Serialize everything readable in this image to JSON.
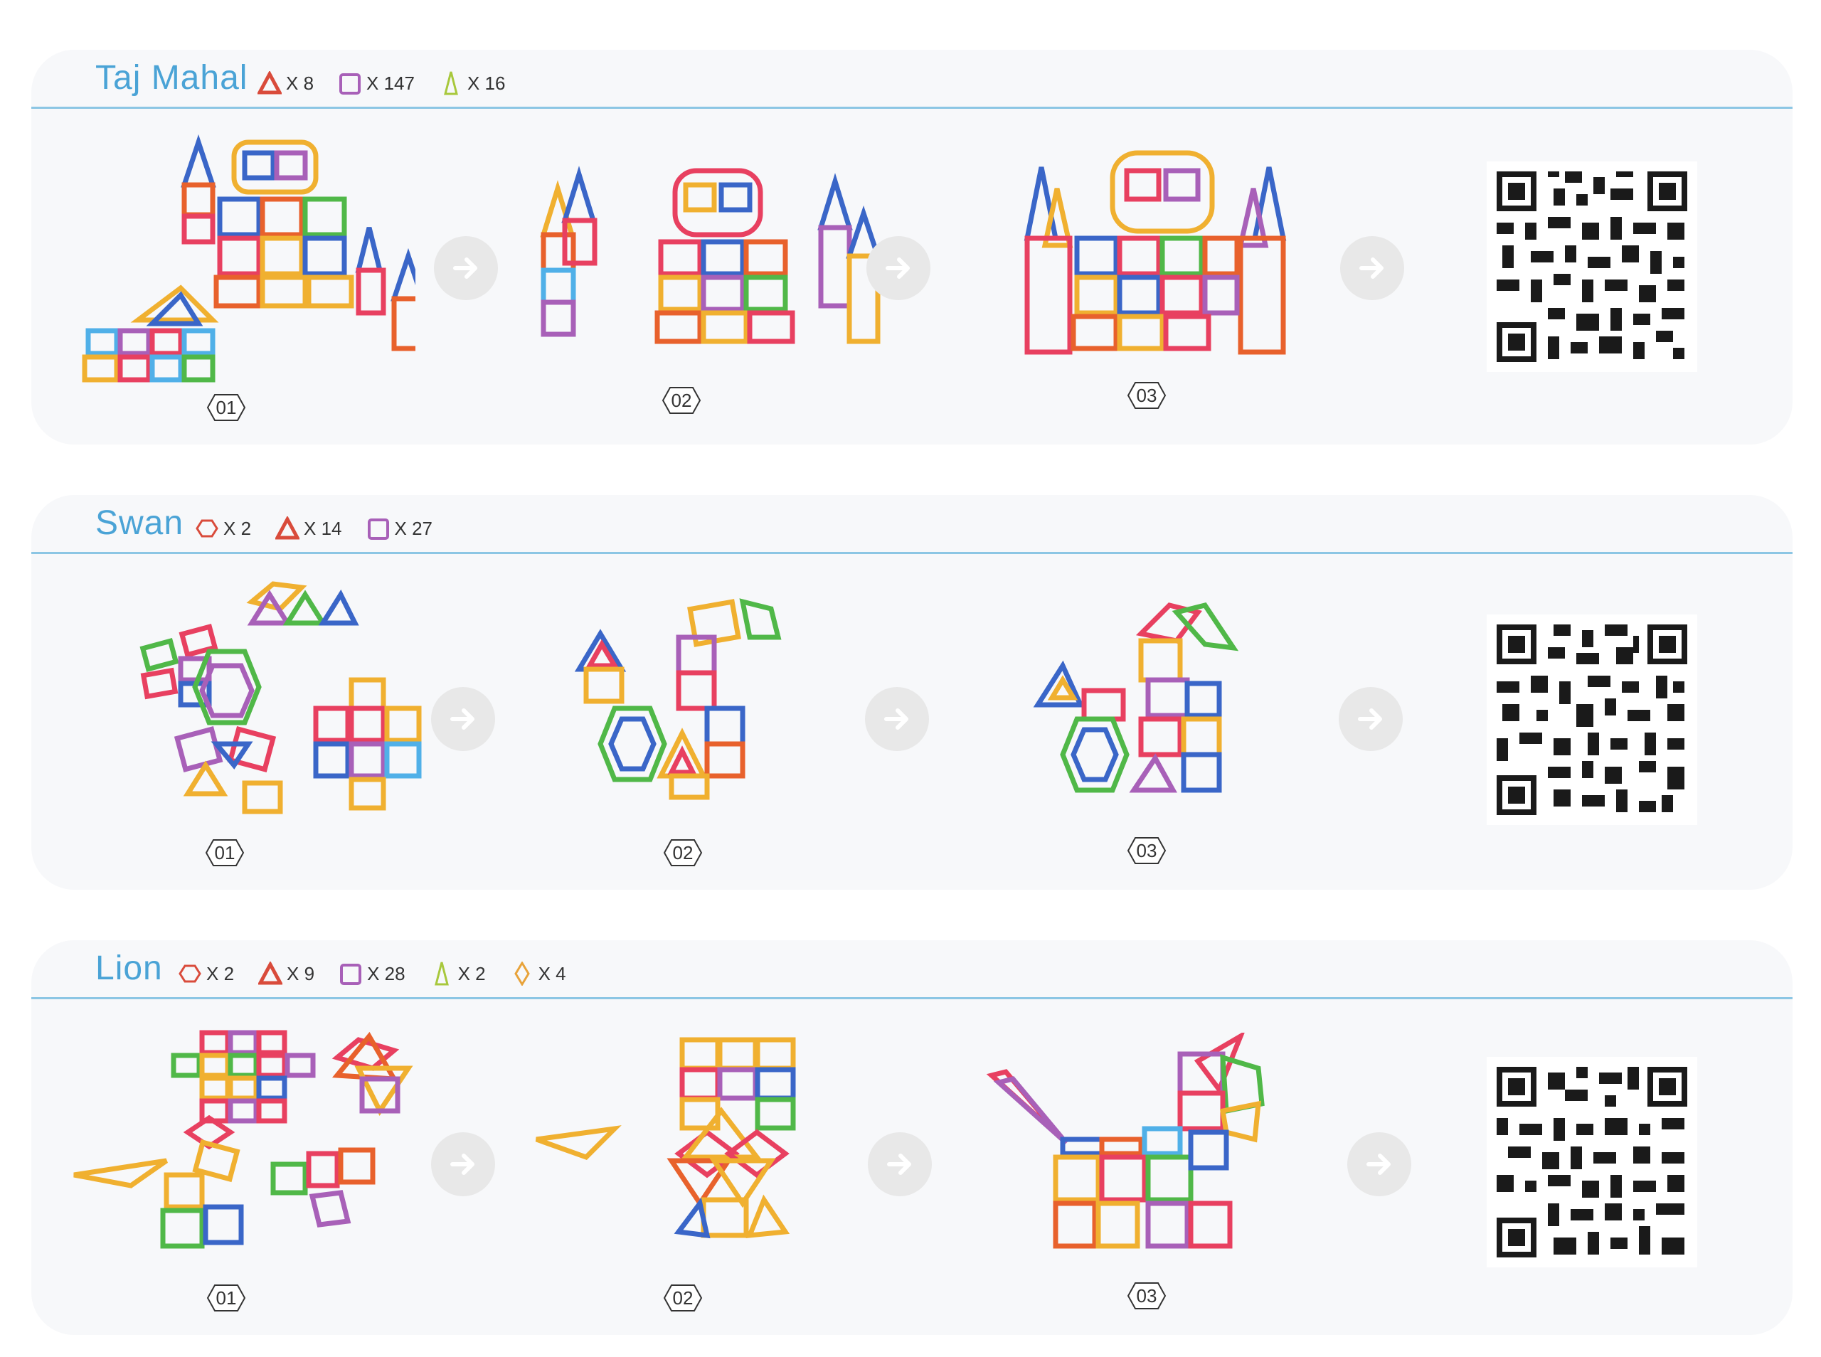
{
  "sections": [
    {
      "title": "Taj Mahal",
      "pieces": [
        {
          "icon": "triangle-piece-icon",
          "count": "X 8",
          "color": "#d94b3b"
        },
        {
          "icon": "square-piece-icon",
          "count": "X 147",
          "color": "#a860b8"
        },
        {
          "icon": "long-triangle-piece-icon",
          "count": "X 16",
          "color": "#a8c83c"
        }
      ],
      "steps": [
        "01",
        "02",
        "03"
      ]
    },
    {
      "title": "Swan",
      "pieces": [
        {
          "icon": "hexagon-piece-icon",
          "count": "X 2",
          "color": "#d94b3b"
        },
        {
          "icon": "triangle-piece-icon",
          "count": "X 14",
          "color": "#d94b3b"
        },
        {
          "icon": "square-piece-icon",
          "count": "X 27",
          "color": "#a860b8"
        }
      ],
      "steps": [
        "01",
        "02",
        "03"
      ]
    },
    {
      "title": "Lion",
      "pieces": [
        {
          "icon": "hexagon-piece-icon",
          "count": "X 2",
          "color": "#d94b3b"
        },
        {
          "icon": "triangle-piece-icon",
          "count": "X 9",
          "color": "#d94b3b"
        },
        {
          "icon": "square-piece-icon",
          "count": "X 28",
          "color": "#a860b8"
        },
        {
          "icon": "long-triangle-piece-icon",
          "count": "X 2",
          "color": "#a8c83c"
        },
        {
          "icon": "rhombus-piece-icon",
          "count": "X 4",
          "color": "#e8a33a"
        }
      ],
      "steps": [
        "01",
        "02",
        "03"
      ]
    }
  ],
  "colors": {
    "title": "#4aa3d6",
    "rule": "#8cc6e4",
    "panel": "#f7f8fa",
    "arrow": "#e8e8e8"
  }
}
